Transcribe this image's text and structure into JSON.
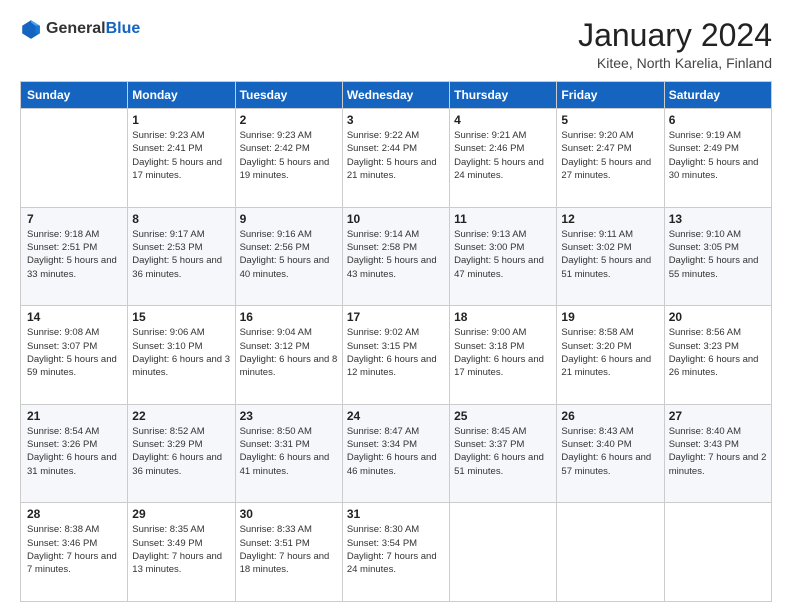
{
  "header": {
    "logo_general": "General",
    "logo_blue": "Blue",
    "month_title": "January 2024",
    "location": "Kitee, North Karelia, Finland"
  },
  "days_of_week": [
    "Sunday",
    "Monday",
    "Tuesday",
    "Wednesday",
    "Thursday",
    "Friday",
    "Saturday"
  ],
  "weeks": [
    [
      {
        "day": "",
        "sunrise": "",
        "sunset": "",
        "daylight": ""
      },
      {
        "day": "1",
        "sunrise": "Sunrise: 9:23 AM",
        "sunset": "Sunset: 2:41 PM",
        "daylight": "Daylight: 5 hours and 17 minutes."
      },
      {
        "day": "2",
        "sunrise": "Sunrise: 9:23 AM",
        "sunset": "Sunset: 2:42 PM",
        "daylight": "Daylight: 5 hours and 19 minutes."
      },
      {
        "day": "3",
        "sunrise": "Sunrise: 9:22 AM",
        "sunset": "Sunset: 2:44 PM",
        "daylight": "Daylight: 5 hours and 21 minutes."
      },
      {
        "day": "4",
        "sunrise": "Sunrise: 9:21 AM",
        "sunset": "Sunset: 2:46 PM",
        "daylight": "Daylight: 5 hours and 24 minutes."
      },
      {
        "day": "5",
        "sunrise": "Sunrise: 9:20 AM",
        "sunset": "Sunset: 2:47 PM",
        "daylight": "Daylight: 5 hours and 27 minutes."
      },
      {
        "day": "6",
        "sunrise": "Sunrise: 9:19 AM",
        "sunset": "Sunset: 2:49 PM",
        "daylight": "Daylight: 5 hours and 30 minutes."
      }
    ],
    [
      {
        "day": "7",
        "sunrise": "Sunrise: 9:18 AM",
        "sunset": "Sunset: 2:51 PM",
        "daylight": "Daylight: 5 hours and 33 minutes."
      },
      {
        "day": "8",
        "sunrise": "Sunrise: 9:17 AM",
        "sunset": "Sunset: 2:53 PM",
        "daylight": "Daylight: 5 hours and 36 minutes."
      },
      {
        "day": "9",
        "sunrise": "Sunrise: 9:16 AM",
        "sunset": "Sunset: 2:56 PM",
        "daylight": "Daylight: 5 hours and 40 minutes."
      },
      {
        "day": "10",
        "sunrise": "Sunrise: 9:14 AM",
        "sunset": "Sunset: 2:58 PM",
        "daylight": "Daylight: 5 hours and 43 minutes."
      },
      {
        "day": "11",
        "sunrise": "Sunrise: 9:13 AM",
        "sunset": "Sunset: 3:00 PM",
        "daylight": "Daylight: 5 hours and 47 minutes."
      },
      {
        "day": "12",
        "sunrise": "Sunrise: 9:11 AM",
        "sunset": "Sunset: 3:02 PM",
        "daylight": "Daylight: 5 hours and 51 minutes."
      },
      {
        "day": "13",
        "sunrise": "Sunrise: 9:10 AM",
        "sunset": "Sunset: 3:05 PM",
        "daylight": "Daylight: 5 hours and 55 minutes."
      }
    ],
    [
      {
        "day": "14",
        "sunrise": "Sunrise: 9:08 AM",
        "sunset": "Sunset: 3:07 PM",
        "daylight": "Daylight: 5 hours and 59 minutes."
      },
      {
        "day": "15",
        "sunrise": "Sunrise: 9:06 AM",
        "sunset": "Sunset: 3:10 PM",
        "daylight": "Daylight: 6 hours and 3 minutes."
      },
      {
        "day": "16",
        "sunrise": "Sunrise: 9:04 AM",
        "sunset": "Sunset: 3:12 PM",
        "daylight": "Daylight: 6 hours and 8 minutes."
      },
      {
        "day": "17",
        "sunrise": "Sunrise: 9:02 AM",
        "sunset": "Sunset: 3:15 PM",
        "daylight": "Daylight: 6 hours and 12 minutes."
      },
      {
        "day": "18",
        "sunrise": "Sunrise: 9:00 AM",
        "sunset": "Sunset: 3:18 PM",
        "daylight": "Daylight: 6 hours and 17 minutes."
      },
      {
        "day": "19",
        "sunrise": "Sunrise: 8:58 AM",
        "sunset": "Sunset: 3:20 PM",
        "daylight": "Daylight: 6 hours and 21 minutes."
      },
      {
        "day": "20",
        "sunrise": "Sunrise: 8:56 AM",
        "sunset": "Sunset: 3:23 PM",
        "daylight": "Daylight: 6 hours and 26 minutes."
      }
    ],
    [
      {
        "day": "21",
        "sunrise": "Sunrise: 8:54 AM",
        "sunset": "Sunset: 3:26 PM",
        "daylight": "Daylight: 6 hours and 31 minutes."
      },
      {
        "day": "22",
        "sunrise": "Sunrise: 8:52 AM",
        "sunset": "Sunset: 3:29 PM",
        "daylight": "Daylight: 6 hours and 36 minutes."
      },
      {
        "day": "23",
        "sunrise": "Sunrise: 8:50 AM",
        "sunset": "Sunset: 3:31 PM",
        "daylight": "Daylight: 6 hours and 41 minutes."
      },
      {
        "day": "24",
        "sunrise": "Sunrise: 8:47 AM",
        "sunset": "Sunset: 3:34 PM",
        "daylight": "Daylight: 6 hours and 46 minutes."
      },
      {
        "day": "25",
        "sunrise": "Sunrise: 8:45 AM",
        "sunset": "Sunset: 3:37 PM",
        "daylight": "Daylight: 6 hours and 51 minutes."
      },
      {
        "day": "26",
        "sunrise": "Sunrise: 8:43 AM",
        "sunset": "Sunset: 3:40 PM",
        "daylight": "Daylight: 6 hours and 57 minutes."
      },
      {
        "day": "27",
        "sunrise": "Sunrise: 8:40 AM",
        "sunset": "Sunset: 3:43 PM",
        "daylight": "Daylight: 7 hours and 2 minutes."
      }
    ],
    [
      {
        "day": "28",
        "sunrise": "Sunrise: 8:38 AM",
        "sunset": "Sunset: 3:46 PM",
        "daylight": "Daylight: 7 hours and 7 minutes."
      },
      {
        "day": "29",
        "sunrise": "Sunrise: 8:35 AM",
        "sunset": "Sunset: 3:49 PM",
        "daylight": "Daylight: 7 hours and 13 minutes."
      },
      {
        "day": "30",
        "sunrise": "Sunrise: 8:33 AM",
        "sunset": "Sunset: 3:51 PM",
        "daylight": "Daylight: 7 hours and 18 minutes."
      },
      {
        "day": "31",
        "sunrise": "Sunrise: 8:30 AM",
        "sunset": "Sunset: 3:54 PM",
        "daylight": "Daylight: 7 hours and 24 minutes."
      },
      {
        "day": "",
        "sunrise": "",
        "sunset": "",
        "daylight": ""
      },
      {
        "day": "",
        "sunrise": "",
        "sunset": "",
        "daylight": ""
      },
      {
        "day": "",
        "sunrise": "",
        "sunset": "",
        "daylight": ""
      }
    ]
  ]
}
